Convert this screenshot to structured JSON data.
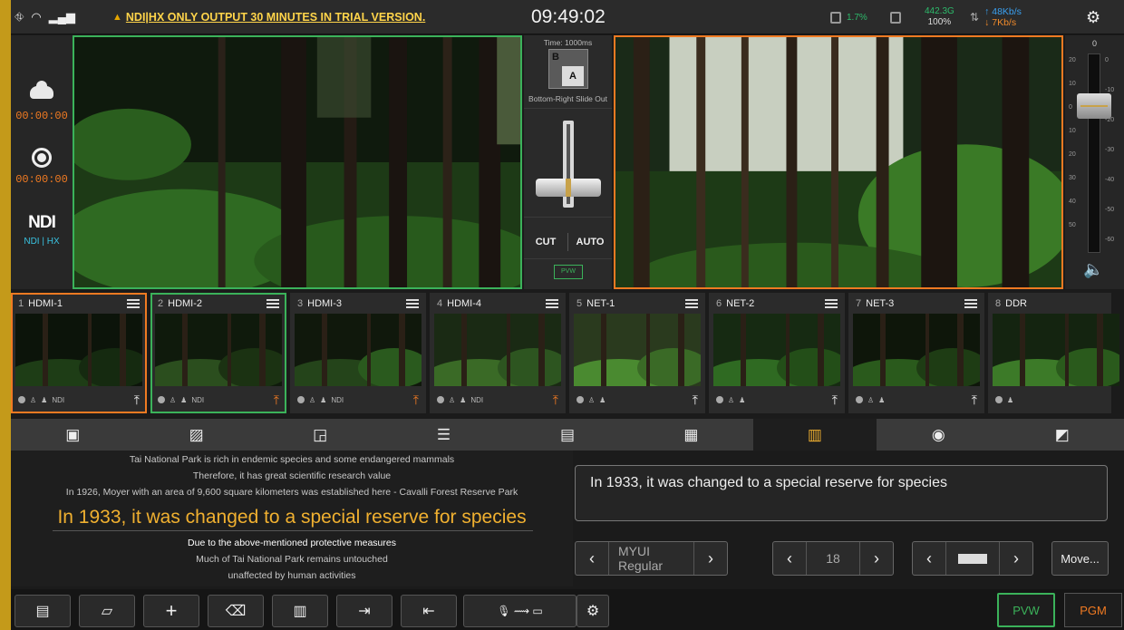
{
  "status": {
    "trial_message": "NDI|HX ONLY OUTPUT 30 MINUTES IN TRIAL VERSION.",
    "clock": "09:49:02",
    "cpu": "1.7%",
    "disk_free": "442.3G",
    "disk_pct": "100%",
    "upload": "↑ 48Kb/s",
    "download": "↓ 7Kb/s"
  },
  "left": {
    "stream_timer": "00:00:00",
    "record_timer": "00:00:00",
    "ndi_logo": "NDI",
    "ndi_label": "NDI | HX"
  },
  "transition": {
    "time": "Time: 1000ms",
    "icon_b": "B",
    "icon_a": "A",
    "name": "Bottom-Right Slide Out",
    "cut": "CUT",
    "auto": "AUTO",
    "pvw_mini": "PVW"
  },
  "audio": {
    "top": "0",
    "ticks_left": [
      "20",
      "10",
      "0",
      "10",
      "20",
      "30",
      "40",
      "50"
    ],
    "ticks_right": [
      "0",
      "-10",
      "-20",
      "-30",
      "-40",
      "-50",
      "-60"
    ],
    "fader_level": 0.2
  },
  "sources": [
    {
      "num": "1",
      "name": "HDMI-1",
      "state": "pgm",
      "ndi": "NDI",
      "upload_active": false
    },
    {
      "num": "2",
      "name": "HDMI-2",
      "state": "pvw",
      "ndi": "NDI",
      "upload_active": true
    },
    {
      "num": "3",
      "name": "HDMI-3",
      "state": "",
      "ndi": "NDI",
      "upload_active": true
    },
    {
      "num": "4",
      "name": "HDMI-4",
      "state": "",
      "ndi": "NDI",
      "upload_active": true
    },
    {
      "num": "5",
      "name": "NET-1",
      "state": "",
      "ndi": "",
      "upload_active": false
    },
    {
      "num": "6",
      "name": "NET-2",
      "state": "",
      "ndi": "",
      "upload_active": false
    },
    {
      "num": "7",
      "name": "NET-3",
      "state": "",
      "ndi": "",
      "upload_active": false
    },
    {
      "num": "8",
      "name": "DDR",
      "state": "",
      "ndi": "",
      "upload_active": false
    }
  ],
  "tabs": [
    {
      "icon": "image-icon",
      "glyph": "▣"
    },
    {
      "icon": "image-edit-icon",
      "glyph": "▨"
    },
    {
      "icon": "pip-icon",
      "glyph": "◲"
    },
    {
      "icon": "mixer-icon",
      "glyph": "☰"
    },
    {
      "icon": "folder-icon",
      "glyph": "▤"
    },
    {
      "icon": "calendar-icon",
      "glyph": "▦"
    },
    {
      "icon": "subtitle-icon",
      "glyph": "▥",
      "active": true
    },
    {
      "icon": "overlay-icon",
      "glyph": "◉"
    },
    {
      "icon": "scene-icon",
      "glyph": "◩"
    }
  ],
  "subtitles": {
    "lines": [
      "Tai National Park is rich in endemic species and some endangered mammals",
      "Therefore, it has great scientific research value",
      "In 1926, Moyer with an area of 9,600 square kilometers was established here - Cavalli Forest Reserve Park",
      "In 1933, it was changed to a special reserve for species",
      "Due to the above-mentioned protective measures",
      "Much of Tai National Park remains untouched",
      "unaffected by human activities"
    ],
    "current_index": 3
  },
  "editor": {
    "text": "In 1933, it was changed to a special reserve for species",
    "font": "MYUI Regular",
    "size": "18",
    "move_label": "Move..."
  },
  "toolbar": {
    "pvw": "PVW",
    "pgm": "PGM"
  }
}
